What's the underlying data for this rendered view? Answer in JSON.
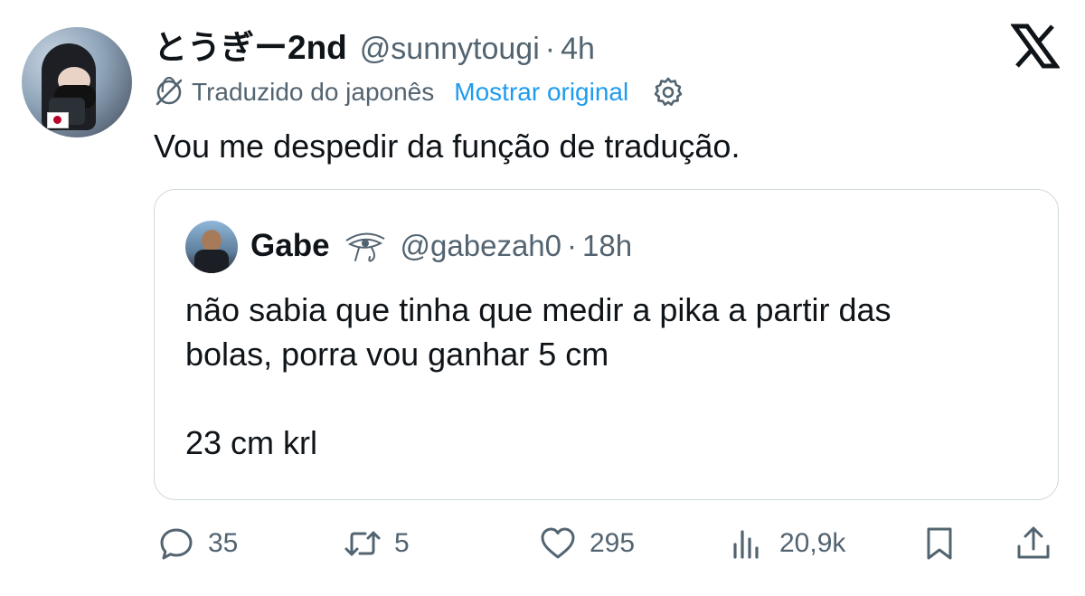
{
  "author": {
    "display_name": "とうぎー2nd",
    "handle": "@sunnytougi",
    "separator": "·",
    "time": "4h"
  },
  "translation": {
    "label": "Traduzido do japonês",
    "show_original": "Mostrar original"
  },
  "tweet_text": "Vou me despedir da função de tradução.",
  "quoted": {
    "display_name": "Gabe",
    "handle": "@gabezah0",
    "separator": "·",
    "time": "18h",
    "text": "não sabia que tinha que medir a pika a partir das\nbolas, porra vou ganhar 5 cm\n\n23 cm krl"
  },
  "actions": {
    "replies": "35",
    "reposts": "5",
    "likes": "295",
    "views": "20,9k"
  },
  "colors": {
    "text": "#0f1419",
    "muted": "#536471",
    "link": "#1d9bf0",
    "border": "#cfd9de"
  },
  "icons": {
    "brand": "x-logo-icon",
    "translate": "translate-globe-icon",
    "settings": "gear-icon",
    "reply": "reply-bubble-icon",
    "repost": "repost-arrows-icon",
    "like": "heart-icon",
    "views": "views-bars-icon",
    "bookmark": "bookmark-icon",
    "share": "share-upload-icon"
  }
}
